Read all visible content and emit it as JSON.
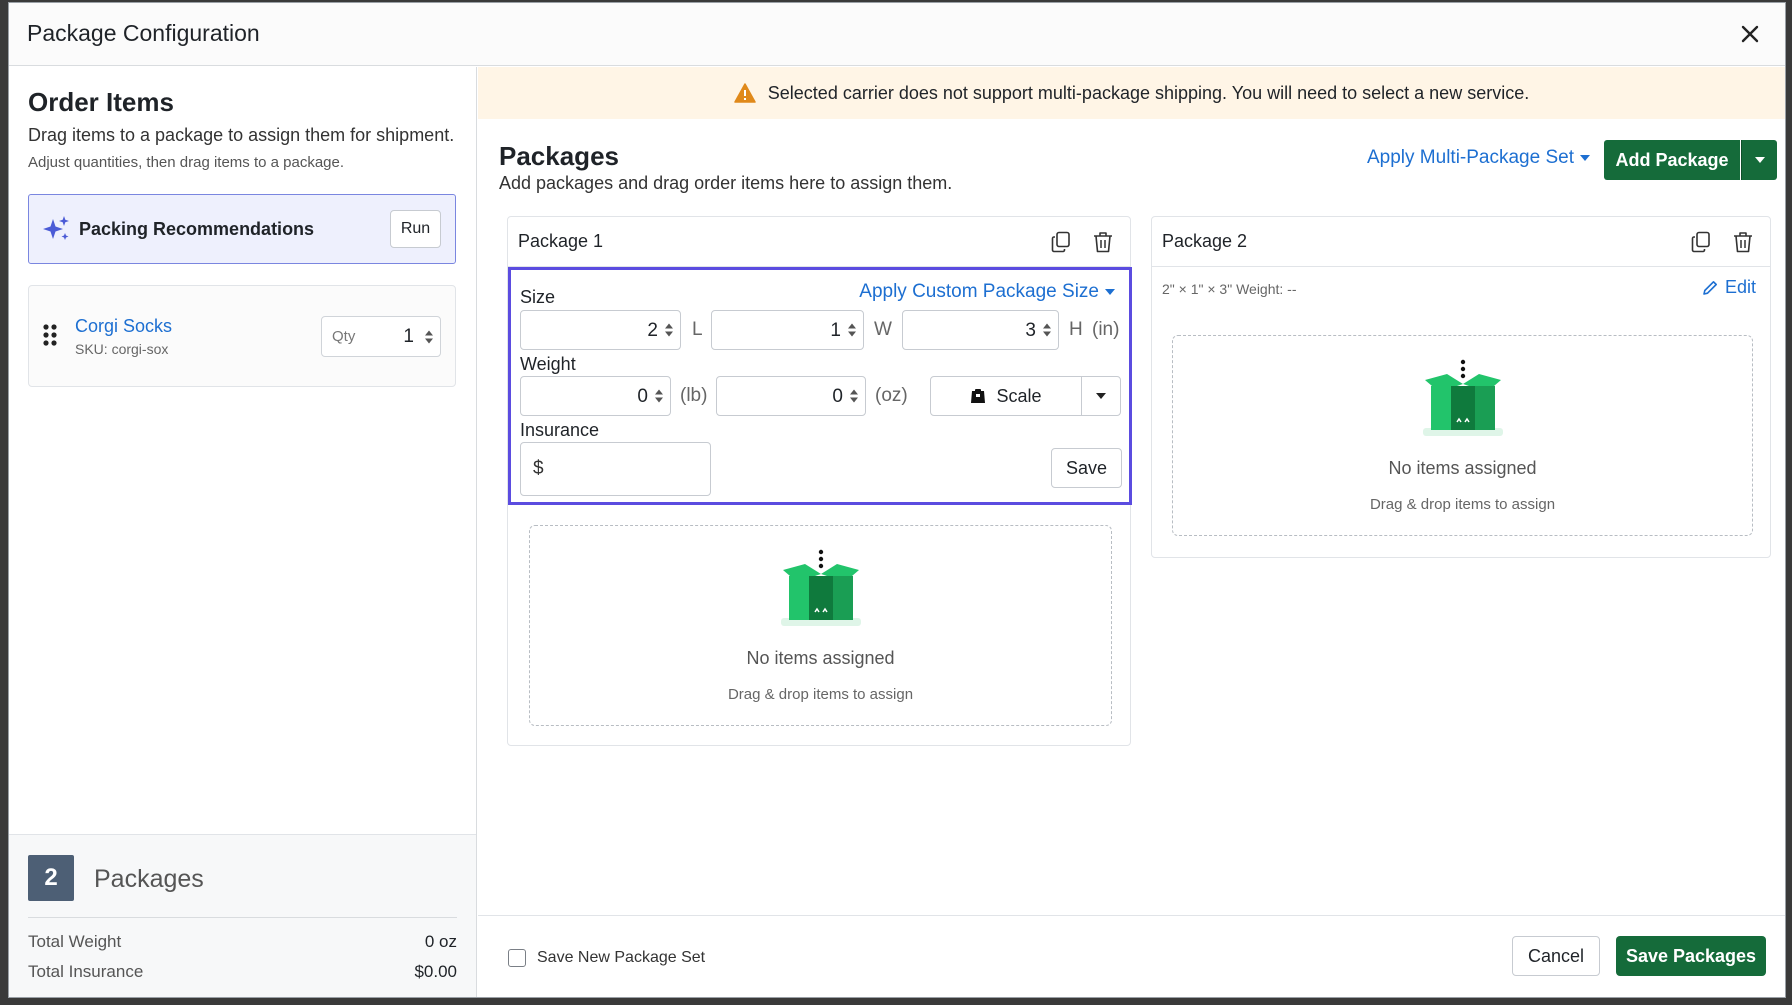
{
  "modal": {
    "title": "Package Configuration"
  },
  "order": {
    "title": "Order Items",
    "desc": "Drag items to a package to assign them for shipment.",
    "subdesc": "Adjust quantities, then drag items to a package.",
    "recommendations": {
      "label": "Packing Recommendations",
      "run": "Run"
    },
    "items": [
      {
        "name": "Corgi Socks",
        "sku": "SKU: corgi-sox",
        "qty_label": "Qty",
        "qty": "1"
      }
    ]
  },
  "summary": {
    "count": "2",
    "label": "Packages",
    "total_weight_label": "Total Weight",
    "total_weight": "0 oz",
    "total_insurance_label": "Total Insurance",
    "total_insurance": "$0.00"
  },
  "warning": "Selected carrier does not support multi-package shipping. You will need to select a new service.",
  "packages": {
    "title": "Packages",
    "desc": "Add packages and drag order items here to assign them.",
    "apply_multi": "Apply Multi-Package Set",
    "add_package": "Add Package",
    "list": [
      {
        "name": "Package 1",
        "size_label": "Size",
        "apply_custom": "Apply Custom Package Size",
        "length": "2",
        "l_unit": "L",
        "width": "1",
        "w_unit": "W",
        "height": "3",
        "h_unit": "H",
        "dim_unit": "(in)",
        "weight_label": "Weight",
        "lb": "0",
        "lb_unit": "(lb)",
        "oz": "0",
        "oz_unit": "(oz)",
        "scale": "Scale",
        "insurance_label": "Insurance",
        "insurance_symbol": "$",
        "save": "Save",
        "empty_title": "No items assigned",
        "empty_hint": "Drag & drop items to assign"
      },
      {
        "name": "Package 2",
        "info": "2\" × 1\" × 3\"  Weight: --",
        "edit": "Edit",
        "empty_title": "No items assigned",
        "empty_hint": "Drag & drop items to assign"
      }
    ]
  },
  "footer": {
    "save_set": "Save New Package Set",
    "cancel": "Cancel",
    "save_packages": "Save Packages"
  },
  "colors": {
    "primary_green": "#156b3a",
    "link_blue": "#1d6fd1",
    "focus_purple": "#5b4ce0",
    "warning_bg": "#fff5e6",
    "warning_icon": "#e0891a",
    "box_green": "#22c46b"
  }
}
